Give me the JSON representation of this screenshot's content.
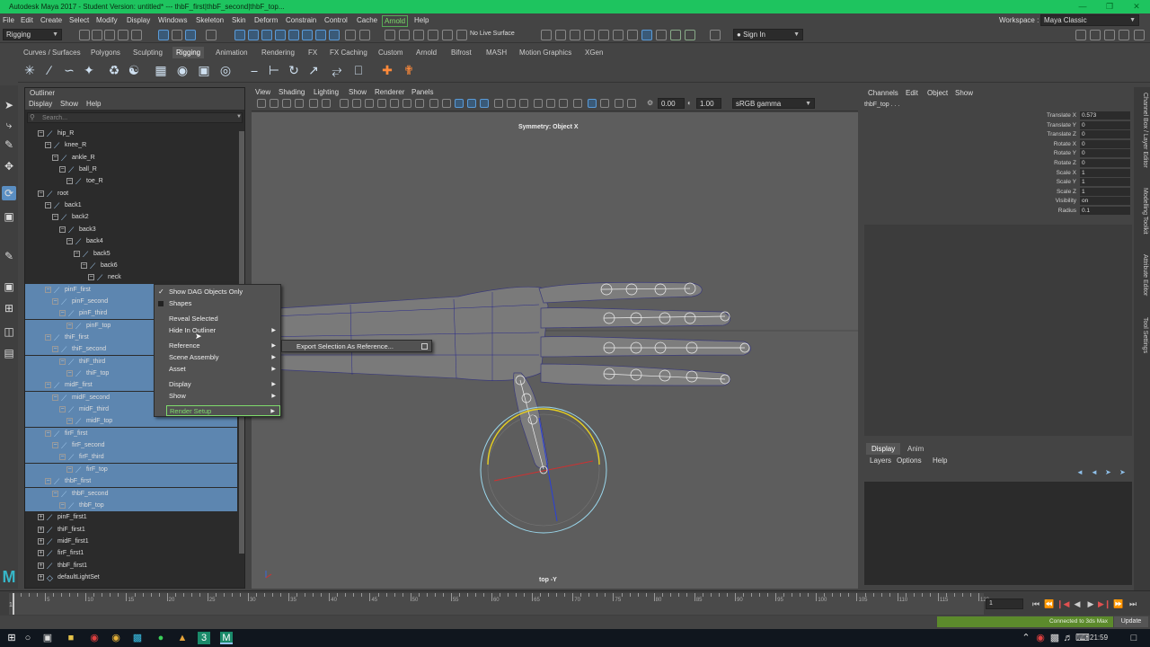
{
  "window": {
    "title": "Autodesk Maya 2017 - Student Version: untitled*   ---   thbF_first|thbF_second|thbF_top...",
    "workspace_label": "Workspace :",
    "workspace_value": "Maya Classic"
  },
  "menubar": {
    "items": [
      "File",
      "Edit",
      "Create",
      "Select",
      "Modify",
      "Display",
      "Windows",
      "Skeleton",
      "Skin",
      "Deform",
      "Constrain",
      "Control",
      "Cache",
      "Arnold",
      "Help"
    ]
  },
  "statusline": {
    "mode": "Rigging",
    "live_surface": "No Live Surface",
    "sign_in": "Sign In"
  },
  "shelf": {
    "tabs": [
      "Curves / Surfaces",
      "Polygons",
      "Sculpting",
      "Rigging",
      "Animation",
      "Rendering",
      "FX",
      "FX Caching",
      "Custom",
      "Arnold",
      "Bifrost",
      "MASH",
      "Motion Graphics",
      "XGen"
    ],
    "active_tab": "Rigging"
  },
  "outliner": {
    "title": "Outliner",
    "menu": [
      "Display",
      "Show",
      "Help"
    ],
    "search_placeholder": "Search...",
    "rows": [
      {
        "label": "hip_R",
        "depth": 1,
        "selected": false
      },
      {
        "label": "knee_R",
        "depth": 2,
        "selected": false
      },
      {
        "label": "ankle_R",
        "depth": 3,
        "selected": false
      },
      {
        "label": "ball_R",
        "depth": 4,
        "selected": false
      },
      {
        "label": "toe_R",
        "depth": 5,
        "selected": false
      },
      {
        "label": "root",
        "depth": 1,
        "selected": false
      },
      {
        "label": "back1",
        "depth": 2,
        "selected": false
      },
      {
        "label": "back2",
        "depth": 3,
        "selected": false
      },
      {
        "label": "back3",
        "depth": 4,
        "selected": false
      },
      {
        "label": "back4",
        "depth": 5,
        "selected": false
      },
      {
        "label": "back5",
        "depth": 6,
        "selected": false
      },
      {
        "label": "back6",
        "depth": 7,
        "selected": false
      },
      {
        "label": "neck",
        "depth": 8,
        "selected": false
      },
      {
        "label": "pinF_first",
        "depth": 2,
        "selected": true
      },
      {
        "label": "pinF_second",
        "depth": 3,
        "selected": true
      },
      {
        "label": "pinF_third",
        "depth": 4,
        "selected": true
      },
      {
        "label": "pinF_top",
        "depth": 5,
        "selected": true
      },
      {
        "label": "thiF_first",
        "depth": 2,
        "selected": true
      },
      {
        "label": "thiF_second",
        "depth": 3,
        "selected": true
      },
      {
        "label": "thiF_third",
        "depth": 4,
        "selected": true
      },
      {
        "label": "thiF_top",
        "depth": 5,
        "selected": true
      },
      {
        "label": "midF_first",
        "depth": 2,
        "selected": true
      },
      {
        "label": "midF_second",
        "depth": 3,
        "selected": true
      },
      {
        "label": "midF_third",
        "depth": 4,
        "selected": true
      },
      {
        "label": "midF_top",
        "depth": 5,
        "selected": true
      },
      {
        "label": "firF_first",
        "depth": 2,
        "selected": true
      },
      {
        "label": "firF_second",
        "depth": 3,
        "selected": true
      },
      {
        "label": "firF_third",
        "depth": 4,
        "selected": true
      },
      {
        "label": "firF_top",
        "depth": 5,
        "selected": true
      },
      {
        "label": "thbF_first",
        "depth": 2,
        "selected": true
      },
      {
        "label": "thbF_second",
        "depth": 3,
        "selected": true
      },
      {
        "label": "thbF_top",
        "depth": 4,
        "selected": true
      },
      {
        "label": "pinF_first1",
        "depth": 1,
        "selected": false
      },
      {
        "label": "thiF_first1",
        "depth": 1,
        "selected": false
      },
      {
        "label": "midF_first1",
        "depth": 1,
        "selected": false
      },
      {
        "label": "firF_first1",
        "depth": 1,
        "selected": false
      },
      {
        "label": "thbF_first1",
        "depth": 1,
        "selected": false
      },
      {
        "label": "defaultLightSet",
        "depth": 1,
        "selected": false
      }
    ]
  },
  "context_menu": {
    "items": [
      {
        "label": "Show DAG Objects Only",
        "type": "check",
        "checked": true
      },
      {
        "label": "Shapes",
        "type": "box"
      },
      {
        "label": "Reveal Selected",
        "type": "plain"
      },
      {
        "label": "Hide In Outliner",
        "type": "sub"
      },
      {
        "label": "Reference",
        "type": "sub"
      },
      {
        "label": "Scene Assembly",
        "type": "sub"
      },
      {
        "label": "Asset",
        "type": "sub"
      },
      {
        "label": "Display",
        "type": "sub"
      },
      {
        "label": "Show",
        "type": "sub"
      },
      {
        "label": "Render Setup",
        "type": "green"
      }
    ],
    "submenu_item": "Export Selection As Reference..."
  },
  "viewport": {
    "menu": [
      "View",
      "Shading",
      "Lighting",
      "Show",
      "Renderer",
      "Panels"
    ],
    "exposure": "0.00",
    "gamma": "1.00",
    "color_space": "sRGB gamma",
    "symmetry_label": "Symmetry: Object X",
    "camera_label": "top -Y"
  },
  "channelbox": {
    "menu": [
      "Channels",
      "Edit",
      "Object",
      "Show"
    ],
    "object_name": "thbF_top . . .",
    "attributes": [
      {
        "name": "Translate X",
        "value": "0.573"
      },
      {
        "name": "Translate Y",
        "value": "0"
      },
      {
        "name": "Translate Z",
        "value": "0"
      },
      {
        "name": "Rotate X",
        "value": "0"
      },
      {
        "name": "Rotate Y",
        "value": "0"
      },
      {
        "name": "Rotate Z",
        "value": "0"
      },
      {
        "name": "Scale X",
        "value": "1"
      },
      {
        "name": "Scale Y",
        "value": "1"
      },
      {
        "name": "Scale Z",
        "value": "1"
      },
      {
        "name": "Visibility",
        "value": "on"
      },
      {
        "name": "Radius",
        "value": "0.1"
      }
    ]
  },
  "layer_panel": {
    "tabs": [
      "Display",
      "Anim"
    ],
    "menu": [
      "Layers",
      "Options",
      "Help"
    ]
  },
  "side_tabs": [
    "Channel Box / Layer Editor",
    "Modelling Toolkit",
    "Attribute Editor",
    "Tool Settings"
  ],
  "timeslider": {
    "tick_labels": [
      "5",
      "10",
      "15",
      "20",
      "25",
      "30",
      "35",
      "40",
      "45",
      "50",
      "55",
      "60",
      "65",
      "70",
      "75",
      "80",
      "85",
      "90",
      "95",
      "100",
      "105",
      "110",
      "115",
      "120"
    ],
    "start_label": "1",
    "current_frame": "1"
  },
  "helpline": {
    "connection": "Connected to 3ds Max",
    "update_label": "Update"
  },
  "taskbar": {
    "clock": "21:59"
  }
}
